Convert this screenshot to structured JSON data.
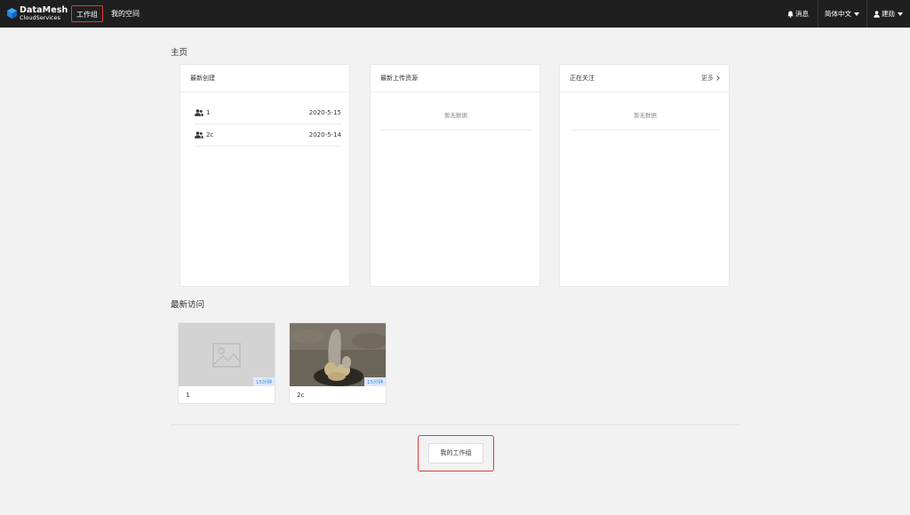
{
  "brand": {
    "line1": "DataMesh",
    "line2": "CloudServices"
  },
  "nav": {
    "workgroup": "工作组",
    "myspace": "我的空间"
  },
  "topright": {
    "messages": "消息",
    "language": "简体中文",
    "user": "建勋"
  },
  "page": {
    "home_title": "主页",
    "recent_visits_title": "最新访问"
  },
  "cards": {
    "recent_created": {
      "title": "最新创建",
      "rows": [
        {
          "name": "1",
          "date": "2020-5-15"
        },
        {
          "name": "2c",
          "date": "2020-5-14"
        }
      ]
    },
    "recent_uploads": {
      "title": "最新上传资源",
      "empty": "暂无数据"
    },
    "following": {
      "title": "正在关注",
      "more": "更多",
      "empty": "暂无数据"
    }
  },
  "recent_visits": [
    {
      "name": "1",
      "badge": "15分钟"
    },
    {
      "name": "2c",
      "badge": "15分钟"
    }
  ],
  "footer": {
    "my_workgroup_button": "我的工作组"
  },
  "colors": {
    "topbar": "#1f1f1f",
    "highlight": "#e53935",
    "badge_text": "#3a86e0",
    "logo_blue": "#1e88e5"
  }
}
